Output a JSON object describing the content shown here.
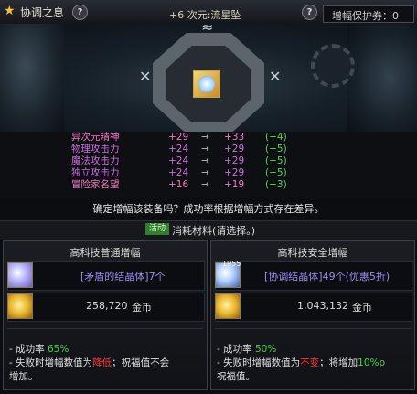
{
  "header": {
    "title": "协调之息",
    "help": "?",
    "item_name": "+6 次元:流星坠",
    "protect_label": "增幅保护券：0"
  },
  "scene": {
    "runes": [
      "✕",
      "✕",
      "≈"
    ]
  },
  "stats": [
    {
      "name": "异次元精神",
      "old": "+29",
      "arrow": "→",
      "new": "+33",
      "diff": "(+4)"
    },
    {
      "name": "物理攻击力",
      "old": "+24",
      "arrow": "→",
      "new": "+29",
      "diff": "(+5)"
    },
    {
      "name": "魔法攻击力",
      "old": "+24",
      "arrow": "→",
      "new": "+29",
      "diff": "(+5)"
    },
    {
      "name": "独立攻击力",
      "old": "+24",
      "arrow": "→",
      "new": "+29",
      "diff": "(+5)"
    },
    {
      "name": "冒险家名望",
      "old": "+16",
      "arrow": "→",
      "new": "+19",
      "diff": "(+3)"
    }
  ],
  "confirm_text": "确定增幅该装备吗？成功率根据增幅方式存在差异。",
  "consume": {
    "tag": "活动",
    "label": "消耗材料(请选择。)"
  },
  "panel_left": {
    "title": "高科技普通增幅",
    "material": "[矛盾的结晶体]7个",
    "gold": "258,720",
    "gold_unit": "金币",
    "line1_prefix": "- 成功率 ",
    "line1_value": "65%",
    "line2_prefix": "- 失败时增幅数值为",
    "line2_red": "降低",
    "line2_suffix": "；祝福值不会",
    "line3": "增加。"
  },
  "panel_right": {
    "title": "高科技安全增幅",
    "badge": "1955",
    "material": "[协调结晶体]49个(优惠5折)",
    "gold": "1,043,132",
    "gold_unit": "金币",
    "line1_prefix": "- 成功率 ",
    "line1_value": "50%",
    "line2_prefix": "- 失败时增幅数值为",
    "line2_red": "不变",
    "line2_suffix": "；将增加",
    "line2_green": "10%",
    "line2_tail": "p",
    "line3": "祝福值。"
  }
}
